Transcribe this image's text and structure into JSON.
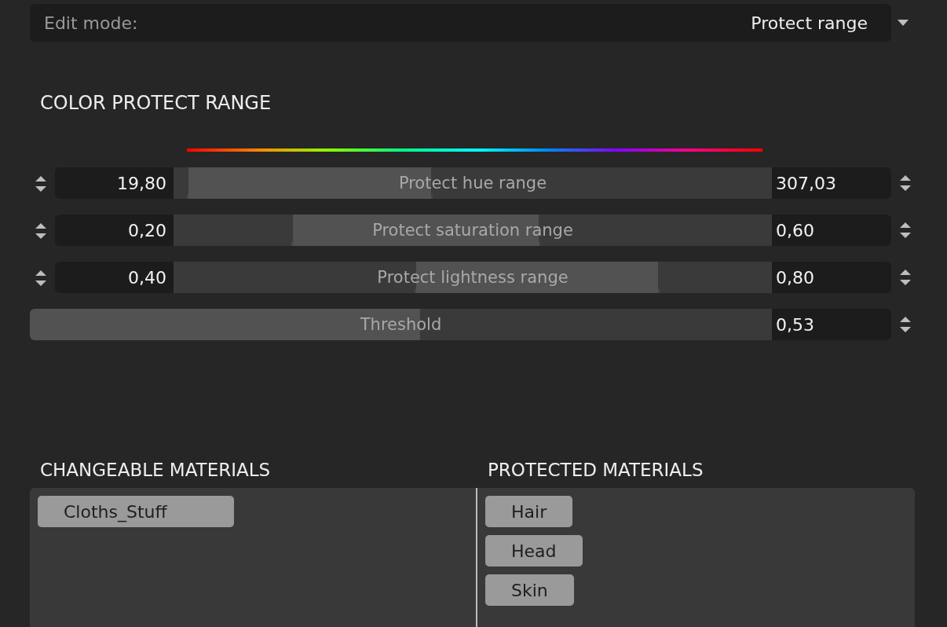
{
  "edit_mode": {
    "label": "Edit mode:",
    "value": "Protect range"
  },
  "color_protect_range": {
    "title": "COLOR PROTECT RANGE",
    "sliders": [
      {
        "kind": "range",
        "label": "Protect hue range",
        "min_value": "19,80",
        "max_value": "307,03",
        "low": {
          "level": 0.025
        },
        "high": {
          "level": 0.43
        }
      },
      {
        "kind": "range",
        "label": "Protect saturation range",
        "min_value": "0,20",
        "max_value": "0,60",
        "low": {
          "level": 0.2
        },
        "high": {
          "level": 0.61
        }
      },
      {
        "kind": "range",
        "label": "Protect lightness range",
        "min_value": "0,40",
        "max_value": "0,80",
        "low": {
          "level": 0.405
        },
        "high": {
          "level": 0.81
        }
      },
      {
        "kind": "single",
        "label": "Threshold",
        "value": "0,53",
        "level": 0.526
      }
    ]
  },
  "materials": {
    "changeable": {
      "title": "CHANGEABLE MATERIALS",
      "items": [
        "Cloths_Stuff"
      ]
    },
    "protected": {
      "title": "PROTECTED MATERIALS",
      "items": [
        "Hair",
        "Head",
        "Skin"
      ]
    }
  }
}
